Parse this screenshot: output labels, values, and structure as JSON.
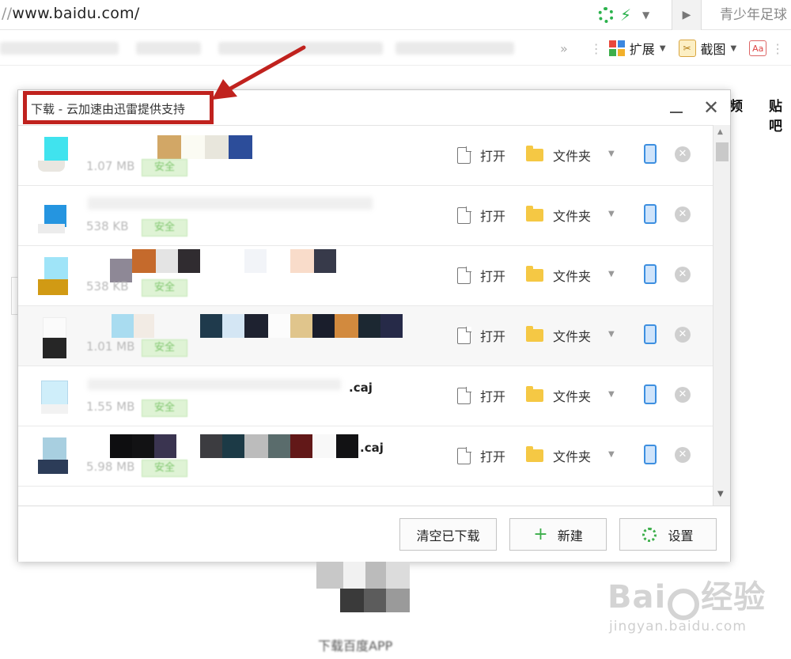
{
  "browser": {
    "url_prefix": "//",
    "url_main": "www.baidu.com/",
    "search_text": "青少年足球",
    "favbar": {
      "extensions_label": "扩展",
      "screenshot_label": "截图"
    },
    "page_nav": [
      "频",
      "贴吧"
    ]
  },
  "dialog": {
    "title": "下载 - 云加速由迅雷提供支持",
    "rows": [
      {
        "size": "1.07 MB",
        "badge": "安全",
        "name_tail": ""
      },
      {
        "size": "538 KB",
        "badge": "安全",
        "name_tail": ""
      },
      {
        "size": "538 KB",
        "badge": "安全",
        "name_tail": ""
      },
      {
        "size": "1.01 MB",
        "badge": "安全",
        "name_tail": ""
      },
      {
        "size": "1.55 MB",
        "badge": "安全",
        "name_tail": ".caj"
      },
      {
        "size": "5.98 MB",
        "badge": "安全",
        "name_tail": ".caj"
      }
    ],
    "actions": {
      "open_label": "打开",
      "folder_label": "文件夹"
    },
    "footer": {
      "clear_label": "清空已下载",
      "new_label": "新建",
      "settings_label": "设置"
    }
  },
  "below": {
    "caption": "下载百度APP"
  },
  "watermark": {
    "logo_left": "Bai",
    "logo_right": "经验",
    "url": "jingyan.baidu.com"
  },
  "colors": {
    "accent_green": "#3cae4a",
    "annotation_red": "#c0221e",
    "folder_yellow": "#f5c844",
    "phone_blue": "#3d8fe0"
  }
}
